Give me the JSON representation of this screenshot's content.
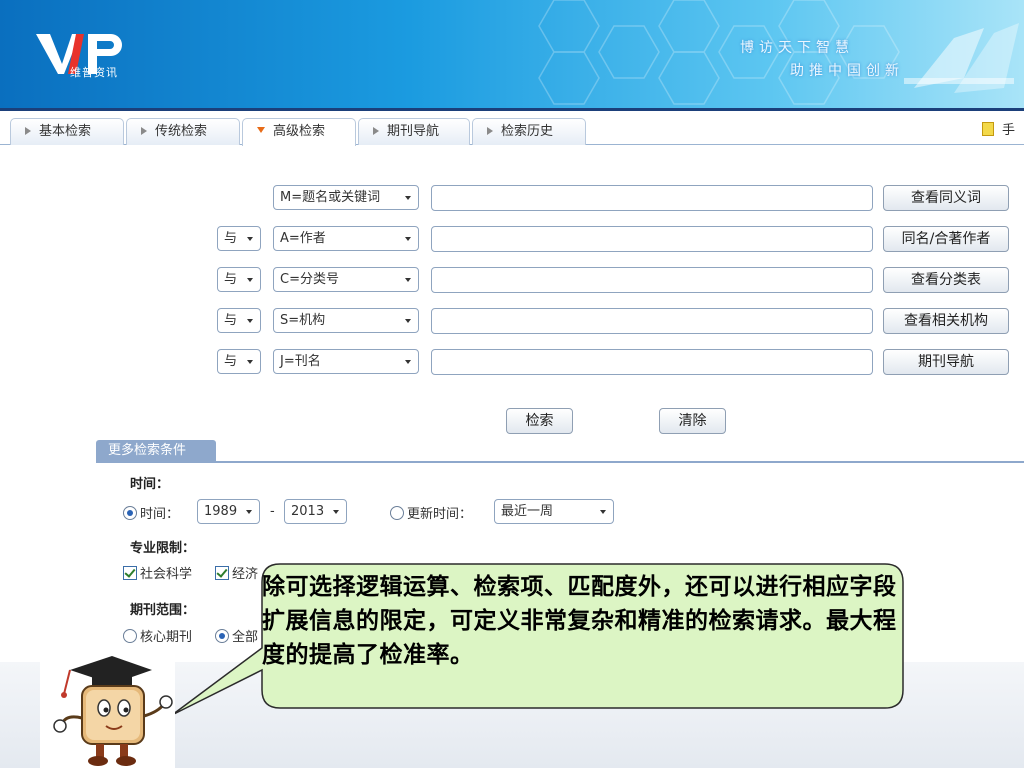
{
  "banner": {
    "logo_text": "VIP",
    "logo_sub": "维普资讯",
    "slogan_line1": "博访天下智慧",
    "slogan_line2": "助推中国创新"
  },
  "tabs": [
    {
      "label": "基本检索",
      "active": false
    },
    {
      "label": "传统检索",
      "active": false
    },
    {
      "label": "高级检索",
      "active": true
    },
    {
      "label": "期刊导航",
      "active": false
    },
    {
      "label": "检索历史",
      "active": false
    }
  ],
  "manual_label": "手",
  "search_rows": [
    {
      "logic": "",
      "field": "M=题名或关键词",
      "value": "",
      "action": "查看同义词"
    },
    {
      "logic": "与",
      "field": "A=作者",
      "value": "",
      "action": "同名/合著作者"
    },
    {
      "logic": "与",
      "field": "C=分类号",
      "value": "",
      "action": "查看分类表"
    },
    {
      "logic": "与",
      "field": "S=机构",
      "value": "",
      "action": "查看相关机构"
    },
    {
      "logic": "与",
      "field": "J=刊名",
      "value": "",
      "action": "期刊导航"
    }
  ],
  "buttons": {
    "search": "检索",
    "clear": "清除"
  },
  "more_conditions": {
    "tab_label": "更多检索条件",
    "time_label": "时间：",
    "time_option": "时间：",
    "year_from": "1989",
    "separator": "-",
    "year_to": "2013",
    "update_option": "更新时间：",
    "update_value": "最近一周",
    "specialty_label": "专业限制：",
    "specialty_items": [
      "社会科学",
      "经济"
    ],
    "journal_label": "期刊范围：",
    "journal_options": [
      "核心期刊",
      "全部"
    ]
  },
  "bubble_text": "除可选择逻辑运算、检索项、匹配度外，还可以进行相应字段扩展信息的限定，可定义非常复杂和精准的检索请求。最大程度的提高了检准率。",
  "colors": {
    "banner_blue": "#1b9be0",
    "bubble_fill": "#dcf5c4",
    "tab_accent": "#e86b17"
  }
}
